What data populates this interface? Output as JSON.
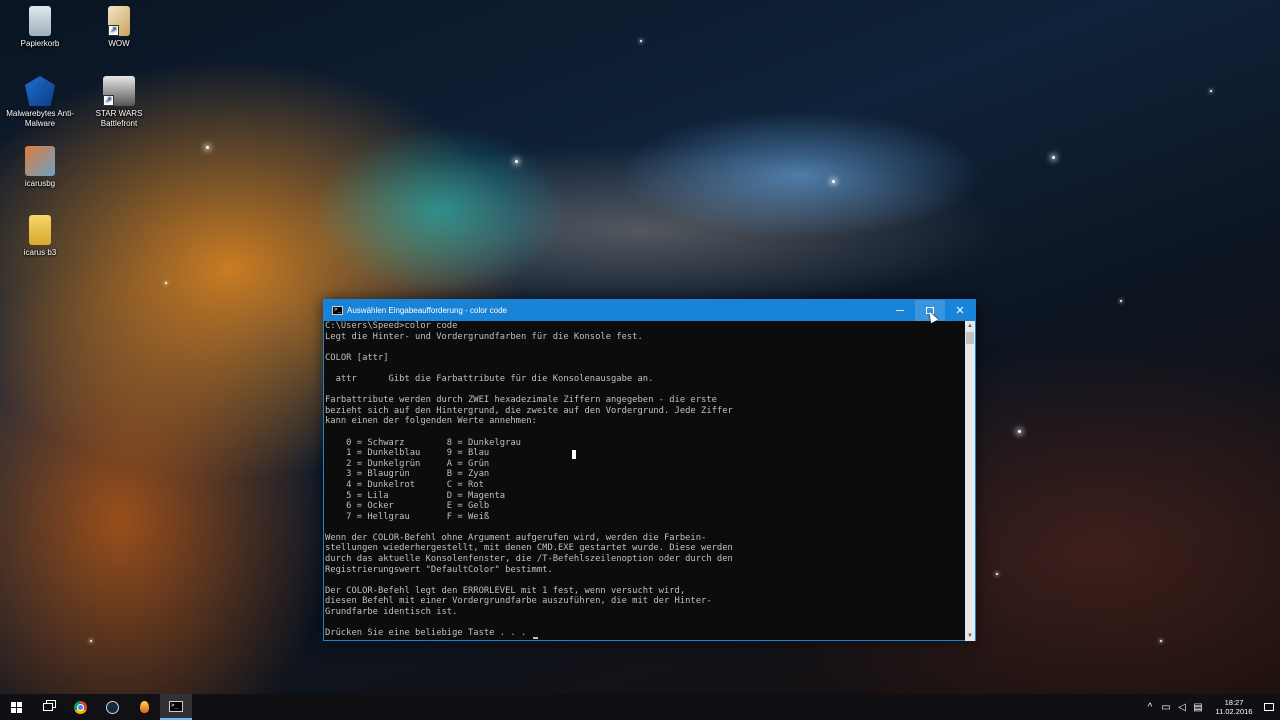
{
  "desktop": {
    "icons": [
      {
        "label": "Papierkorb",
        "icon": "recycle-bin-icon"
      },
      {
        "label": "WOW",
        "icon": "wow-shortcut-icon"
      },
      {
        "label": "Malwarebytes Anti-Malware",
        "icon": "malwarebytes-icon"
      },
      {
        "label": "STAR WARS Battlefront",
        "icon": "star-wars-battlefront-icon"
      },
      {
        "label": "icarusbg",
        "icon": "image-file-icon"
      },
      {
        "label": "icarus b3",
        "icon": "folder-icon"
      }
    ]
  },
  "window": {
    "title": "Auswählen Eingabeaufforderung - color  code",
    "icon": "cmd-icon",
    "controls": {
      "minimize": "─",
      "close": "✕"
    },
    "console_lines": [
      "C:\\Users\\Speed>color code",
      "Legt die Hinter- und Vordergrundfarben für die Konsole fest.",
      "",
      "COLOR [attr]",
      "",
      "  attr      Gibt die Farbattribute für die Konsolenausgabe an.",
      "",
      "Farbattribute werden durch ZWEI hexadezimale Ziffern angegeben - die erste",
      "bezieht sich auf den Hintergrund, die zweite auf den Vordergrund. Jede Ziffer",
      "kann einen der folgenden Werte annehmen:",
      "",
      "    0 = Schwarz        8 = Dunkelgrau",
      "    1 = Dunkelblau     9 = Blau",
      "    2 = Dunkelgrün     A = Grün",
      "    3 = Blaugrün       B = Zyan",
      "    4 = Dunkelrot      C = Rot",
      "    5 = Lila           D = Magenta",
      "    6 = Ocker          E = Gelb",
      "    7 = Hellgrau       F = Weiß",
      "",
      "Wenn der COLOR-Befehl ohne Argument aufgerufen wird, werden die Farbein-",
      "stellungen wiederhergestellt, mit denen CMD.EXE gestartet wurde. Diese werden",
      "durch das aktuelle Konsolenfenster, die /T-Befehlszeilenoption oder durch den",
      "Registrierungswert \"DefaultColor\" bestimmt.",
      "",
      "Der COLOR-Befehl legt den ERRORLEVEL mit 1 fest, wenn versucht wird,",
      "diesen Befehl mit einer Vordergrundfarbe auszuführen, die mit der Hinter-",
      "Grundfarbe identisch ist.",
      "",
      "Drücken Sie eine beliebige Taste . . . "
    ]
  },
  "taskbar": {
    "apps": [
      {
        "name": "start",
        "icon": "windows-logo-icon"
      },
      {
        "name": "task-view",
        "icon": "task-view-icon"
      },
      {
        "name": "chrome",
        "icon": "chrome-icon"
      },
      {
        "name": "steam",
        "icon": "steam-icon"
      },
      {
        "name": "game",
        "icon": "flame-icon"
      },
      {
        "name": "cmd",
        "icon": "cmd-icon",
        "active": true
      }
    ],
    "tray": {
      "chevron": "^",
      "time": "18:27",
      "date": "11.02.2016"
    }
  }
}
